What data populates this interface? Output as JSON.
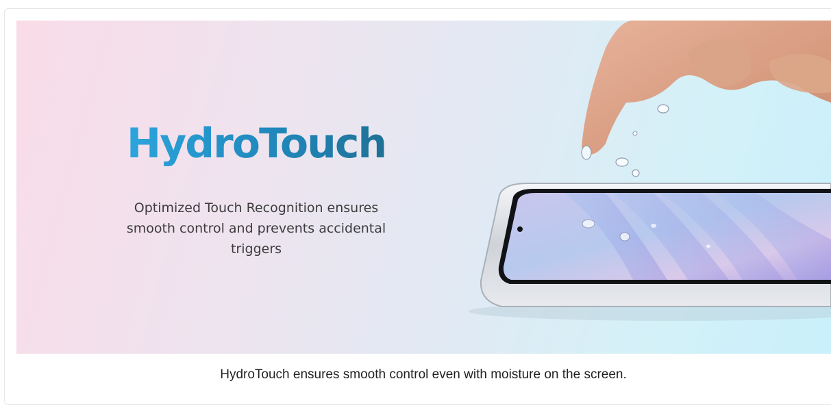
{
  "banner": {
    "headline": "HydroTouch",
    "subtitle": "Optimized Touch Recognition ensures smooth control and prevents accidental triggers",
    "image_alt": "phone-with-water-droplets-and-finger",
    "gradient_colors": [
      "#f9dce8",
      "#e2e9f3",
      "#c9f0fb"
    ],
    "headline_color": "#1f86b9"
  },
  "caption": {
    "text": "HydroTouch ensures smooth control even with moisture on the screen."
  }
}
